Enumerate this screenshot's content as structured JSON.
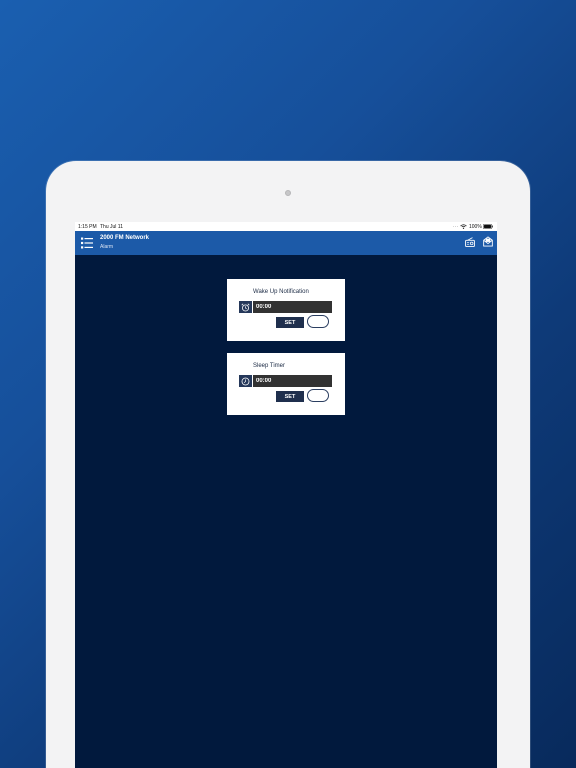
{
  "status_bar": {
    "time": "1:15 PM",
    "date": "Thu Jul 11",
    "dots": "...",
    "battery_percent": "100%",
    "icons": [
      "wifi-icon",
      "battery-icon"
    ]
  },
  "app_bar": {
    "title": "2000 FM Network",
    "subtitle": "Alarm",
    "icons": [
      "menu-icon",
      "radio-icon",
      "mail-icon"
    ]
  },
  "wake_card": {
    "title": "Wake Up Notification",
    "icon": "alarm-clock-icon",
    "time_value": "00:00",
    "set_label": "SET",
    "toggle_on": false
  },
  "sleep_card": {
    "title": "Sleep Timer",
    "icon": "clock-icon",
    "time_value": "00:00",
    "set_label": "SET",
    "toggle_on": false
  },
  "colors": {
    "background_gradient_start": "#1a5fb0",
    "background_gradient_end": "#082a5c",
    "app_bar": "#1c5aa8",
    "screen_bg": "#01193d",
    "input_bg": "#323232",
    "button_bg": "#1f2f4d"
  }
}
